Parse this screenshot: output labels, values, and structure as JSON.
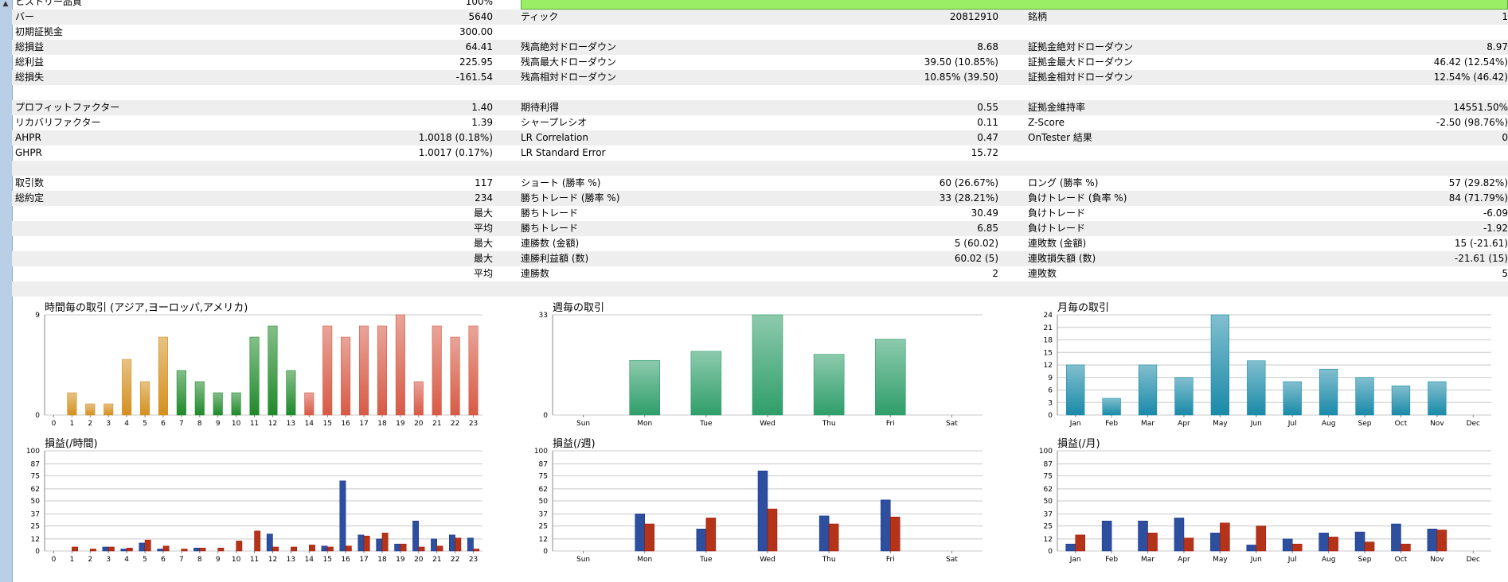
{
  "history_quality": {
    "label": "ヒストリー品質",
    "value": "100%"
  },
  "stats_rows": [
    {
      "c1": "バー",
      "v1": "5640",
      "c2": "ティック",
      "v2": "20812910",
      "c3": "銘柄",
      "v3": "1"
    },
    {
      "c1": "初期証拠金",
      "v1": "300.00",
      "c2": "",
      "v2": "",
      "c3": "",
      "v3": ""
    },
    {
      "c1": "総損益",
      "v1": "64.41",
      "c2": "残高絶対ドローダウン",
      "v2": "8.68",
      "c3": "証拠金絶対ドローダウン",
      "v3": "8.97"
    },
    {
      "c1": "総利益",
      "v1": "225.95",
      "c2": "残高最大ドローダウン",
      "v2": "39.50 (10.85%)",
      "c3": "証拠金最大ドローダウン",
      "v3": "46.42 (12.54%)"
    },
    {
      "c1": "総損失",
      "v1": "-161.54",
      "c2": "残高相対ドローダウン",
      "v2": "10.85% (39.50)",
      "c3": "証拠金相対ドローダウン",
      "v3": "12.54% (46.42)"
    },
    {
      "c1": "",
      "v1": "",
      "c2": "",
      "v2": "",
      "c3": "",
      "v3": ""
    },
    {
      "c1": "プロフィットファクター",
      "v1": "1.40",
      "c2": "期待利得",
      "v2": "0.55",
      "c3": "証拠金維持率",
      "v3": "14551.50%"
    },
    {
      "c1": "リカバリファクター",
      "v1": "1.39",
      "c2": "シャープレシオ",
      "v2": "0.11",
      "c3": "Z-Score",
      "v3": "-2.50 (98.76%)"
    },
    {
      "c1": "AHPR",
      "v1": "1.0018 (0.18%)",
      "c2": "LR Correlation",
      "v2": "0.47",
      "c3": "OnTester 結果",
      "v3": "0"
    },
    {
      "c1": "GHPR",
      "v1": "1.0017 (0.17%)",
      "c2": "LR Standard Error",
      "v2": "15.72",
      "c3": "",
      "v3": ""
    },
    {
      "c1": "",
      "v1": "",
      "c2": "",
      "v2": "",
      "c3": "",
      "v3": ""
    },
    {
      "c1": "取引数",
      "v1": "117",
      "c2": "ショート (勝率 %)",
      "v2": "60 (26.67%)",
      "c3": "ロング (勝率 %)",
      "v3": "57 (29.82%)"
    },
    {
      "c1": "総約定",
      "v1": "234",
      "c2": "勝ちトレード (勝率 %)",
      "v2": "33 (28.21%)",
      "c3": "負けトレード (負率 %)",
      "v3": "84 (71.79%)"
    },
    {
      "c1": "",
      "v1": "最大",
      "c2": "勝ちトレード",
      "v2": "30.49",
      "c3": "負けトレード",
      "v3": "-6.09"
    },
    {
      "c1": "",
      "v1": "平均",
      "c2": "勝ちトレード",
      "v2": "6.85",
      "c3": "負けトレード",
      "v3": "-1.92"
    },
    {
      "c1": "",
      "v1": "最大",
      "c2": "連勝数 (金額)",
      "v2": "5 (60.02)",
      "c3": "連敗数 (金額)",
      "v3": "15 (-21.61)"
    },
    {
      "c1": "",
      "v1": "最大",
      "c2": "連勝利益額 (数)",
      "v2": "60.02 (5)",
      "c3": "連敗損失額 (数)",
      "v3": "-21.61 (15)"
    },
    {
      "c1": "",
      "v1": "平均",
      "c2": "連勝数",
      "v2": "2",
      "c3": "連敗数",
      "v3": "5"
    },
    {
      "c1": "",
      "v1": "",
      "c2": "",
      "v2": "",
      "c3": "",
      "v3": ""
    }
  ],
  "colors": {
    "asia": "#d4901f",
    "europe": "#1f8a2a",
    "america": "#d75a45",
    "week": "#2f9e6a",
    "month": "#1a8aa8",
    "profit": "#2e4f9e",
    "loss": "#b33418",
    "grid": "#c8c8c8",
    "green_bar": "#99ee66"
  },
  "chart_data": [
    {
      "type": "bar",
      "title": "時間毎の取引 (アジア,ヨーロッパ,アメリカ)",
      "categories": [
        "0",
        "1",
        "2",
        "3",
        "4",
        "5",
        "6",
        "7",
        "8",
        "9",
        "10",
        "11",
        "12",
        "13",
        "14",
        "15",
        "16",
        "17",
        "18",
        "19",
        "20",
        "21",
        "22",
        "23"
      ],
      "values": [
        0,
        2,
        1,
        1,
        5,
        3,
        7,
        4,
        3,
        2,
        2,
        7,
        8,
        4,
        2,
        8,
        7,
        8,
        8,
        9,
        3,
        8,
        7,
        8
      ],
      "sessions": [
        "asia",
        "asia",
        "asia",
        "asia",
        "asia",
        "asia",
        "asia",
        "europe",
        "europe",
        "europe",
        "europe",
        "europe",
        "europe",
        "europe",
        "america",
        "america",
        "america",
        "america",
        "america",
        "america",
        "america",
        "america",
        "america",
        "america"
      ],
      "yticks": [
        "0",
        "9"
      ],
      "ylim": [
        0,
        9
      ]
    },
    {
      "type": "bar",
      "title": "週毎の取引",
      "categories": [
        "Sun",
        "Mon",
        "Tue",
        "Wed",
        "Thu",
        "Fri",
        "Sat"
      ],
      "values": [
        0,
        18,
        21,
        33,
        20,
        25,
        0
      ],
      "yticks": [
        "0",
        "33"
      ],
      "ylim": [
        0,
        33
      ]
    },
    {
      "type": "bar",
      "title": "月毎の取引",
      "categories": [
        "Jan",
        "Feb",
        "Mar",
        "Apr",
        "May",
        "Jun",
        "Jul",
        "Aug",
        "Sep",
        "Oct",
        "Nov",
        "Dec"
      ],
      "values": [
        12,
        4,
        12,
        9,
        24,
        13,
        8,
        11,
        9,
        7,
        8,
        0
      ],
      "yticks": [
        "0",
        "3",
        "6",
        "9",
        "12",
        "15",
        "18",
        "21",
        "24"
      ],
      "ylim": [
        0,
        24
      ]
    },
    {
      "type": "bar",
      "title": "損益(/時間)",
      "categories": [
        "0",
        "1",
        "2",
        "3",
        "4",
        "5",
        "6",
        "7",
        "8",
        "9",
        "10",
        "11",
        "12",
        "13",
        "14",
        "15",
        "16",
        "17",
        "18",
        "19",
        "20",
        "21",
        "22",
        "23"
      ],
      "series": [
        {
          "key": "profit",
          "values": [
            0,
            0,
            0,
            4,
            2,
            8,
            2,
            0,
            3,
            0,
            0,
            0,
            17,
            0,
            0,
            5,
            70,
            16,
            12,
            7,
            30,
            12,
            16,
            13
          ]
        },
        {
          "key": "loss",
          "values": [
            0,
            4,
            2,
            4,
            3,
            11,
            5,
            2,
            3,
            3,
            10,
            20,
            4,
            4,
            6,
            4,
            5,
            15,
            18,
            7,
            4,
            5,
            13,
            2
          ]
        }
      ],
      "yticks": [
        "0",
        "12",
        "25",
        "37",
        "50",
        "62",
        "75",
        "87",
        "100"
      ],
      "ylim": [
        0,
        100
      ]
    },
    {
      "type": "bar",
      "title": "損益(/週)",
      "categories": [
        "Sun",
        "Mon",
        "Tue",
        "Wed",
        "Thu",
        "Fri",
        "Sat"
      ],
      "series": [
        {
          "key": "profit",
          "values": [
            0,
            37,
            22,
            80,
            35,
            51,
            0
          ]
        },
        {
          "key": "loss",
          "values": [
            0,
            27,
            33,
            42,
            27,
            34,
            0
          ]
        }
      ],
      "yticks": [
        "0",
        "12",
        "25",
        "37",
        "50",
        "62",
        "75",
        "87",
        "100"
      ],
      "ylim": [
        0,
        100
      ]
    },
    {
      "type": "bar",
      "title": "損益(/月)",
      "categories": [
        "Jan",
        "Feb",
        "Mar",
        "Apr",
        "May",
        "Jun",
        "Jul",
        "Aug",
        "Sep",
        "Oct",
        "Nov",
        "Dec"
      ],
      "series": [
        {
          "key": "profit",
          "values": [
            7,
            30,
            30,
            33,
            18,
            6,
            12,
            18,
            19,
            27,
            22,
            0
          ]
        },
        {
          "key": "loss",
          "values": [
            16,
            0,
            18,
            13,
            28,
            25,
            7,
            14,
            9,
            7,
            21,
            0
          ]
        }
      ],
      "yticks": [
        "0",
        "12",
        "25",
        "37",
        "50",
        "62",
        "75",
        "87",
        "100"
      ],
      "ylim": [
        0,
        100
      ]
    }
  ]
}
